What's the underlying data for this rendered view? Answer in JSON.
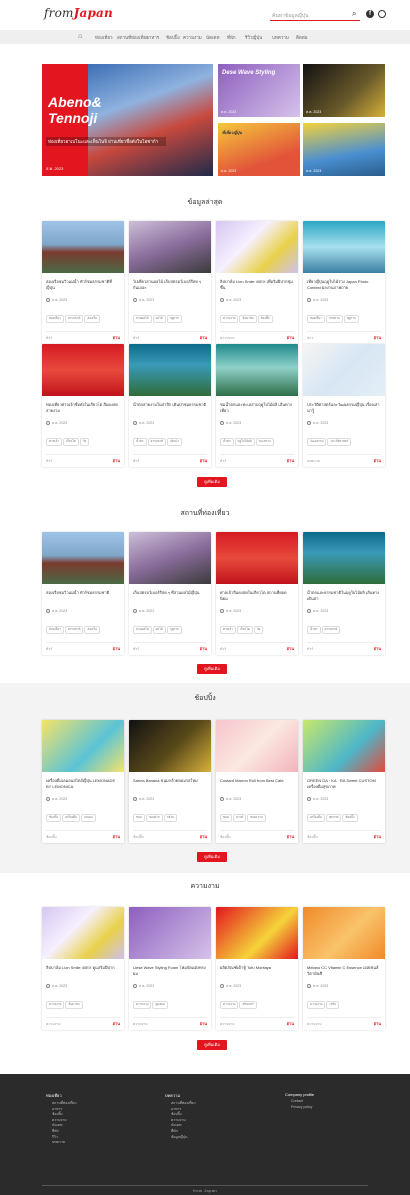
{
  "header": {
    "logo_left": "from",
    "logo_right": "Japan",
    "search_placeholder": "ค้นหาข้อมูลญี่ปุ่น"
  },
  "nav": {
    "items": [
      "ท่องเที่ยว",
      "สถานที่ท่องเที่ยว",
      "อาหาร",
      "ช้อปปิ้ง",
      "ความงาม",
      "นัดเดท",
      "ที่พัก",
      "รีวิวญี่ปุ่น",
      "บทความ",
      "ติดต่อ"
    ]
  },
  "banner": {
    "hero_title_1": "Abeno&",
    "hero_title_2": "Tennoji",
    "hero_sub": "ท่องเที่ยวอาเบโนะและเท็นโนจิ ย่านเที่ยวชื่อดังในโอซาก้า",
    "hero_date": "ส.ค. 2023",
    "tiles": [
      {
        "caption": "Dese Wave Styling",
        "date": "ส.ค. 2023"
      },
      {
        "caption": "",
        "date": "ส.ค. 2023"
      },
      {
        "caption": "ที่เที่ยวญี่ปุ่น",
        "date": "ส.ค. 2023"
      },
      {
        "caption": "",
        "date": "ส.ค. 2023"
      }
    ]
  },
  "sections": {
    "latest": "ข้อมูลล่าสุด",
    "places": "สถานที่ท่องเที่ยว",
    "shopping": "ช้อปปิ้ง",
    "beauty": "ความงาม"
  },
  "more_label": "ดูเพิ่มเติม",
  "read_more": "อ่าน",
  "latest_cards": [
    {
      "title": "ล่องเรือชมวิวแม่น้ำ ทัวร์ชมธรรมชาติที่ญี่ปุ่น",
      "date": "ส.ค. 2023",
      "tags": [
        "ท่องเที่ยว",
        "ธรรมชาติ",
        "ล่องเรือ"
      ],
      "cat": "ทัวร์"
    },
    {
      "title": "ไปเที่ยวสวนผลไม้ เก็บสตรอว์เบอร์รีสด ๆ กันเถอะ",
      "date": "ส.ค. 2023",
      "tags": [
        "สวนผลไม้",
        "ผลไม้",
        "ฤดูกาล"
      ],
      "cat": "ทัวร์"
    },
    {
      "title": "ลิปบาล์ม Lion Smile 40EX เพื่อริมฝีปากชุ่มชื้น",
      "date": "ส.ค. 2023",
      "tags": [
        "ความงาม",
        "ลิปบาล์ม",
        "ช้อปปิ้ง"
      ],
      "cat": "ความงาม"
    },
    {
      "title": "เที่ยวญี่ปุ่นฤดูใบไม้ร่วง Japan Photo Contest ผลงานภาพถ่าย",
      "date": "ส.ค. 2023",
      "tags": [
        "ท่องเที่ยว",
        "ภาพถ่าย",
        "ฤดูกาล"
      ],
      "cat": "ข่าว"
    },
    {
      "title": "ท่องเที่ยวศาลเจ้าชื่อดังในเกียวโต สีแดงสดสวยงาม",
      "date": "ส.ค. 2023",
      "tags": [
        "ศาลเจ้า",
        "เกียวโต",
        "วัด"
      ],
      "cat": "ทัวร์"
    },
    {
      "title": "น้ำตกสวยงามในป่าลึก เดินป่าชมธรรมชาติ",
      "date": "ส.ค. 2023",
      "tags": [
        "น้ำตก",
        "ธรรมชาติ",
        "เดินป่า"
      ],
      "cat": "ทัวร์"
    },
    {
      "title": "ชมน้ำตกและทะเลสาบฤดูใบไม้ผลิ เส้นทางเที่ยว",
      "date": "ส.ค. 2023",
      "tags": [
        "น้ำตก",
        "ฤดูใบไม้ผลิ",
        "ทะเลสาบ"
      ],
      "cat": "ทัวร์"
    },
    {
      "title": "ประวัติศาสตร์และวัฒนธรรมญี่ปุ่น เรื่องเล่าน่ารู้",
      "date": "ส.ค. 2023",
      "tags": [
        "วัฒนธรรม",
        "ประวัติศาสตร์"
      ],
      "cat": "บทความ"
    }
  ],
  "place_cards": [
    {
      "title": "ล่องเรือชมวิวแม่น้ำ ทัวร์ชมธรรมชาติ",
      "date": "ส.ค. 2023",
      "tags": [
        "ท่องเที่ยว",
        "ธรรมชาติ",
        "ล่องเรือ"
      ],
      "cat": "ทัวร์"
    },
    {
      "title": "เก็บสตรอว์เบอร์รีสด ๆ ที่สวนผลไม้ญี่ปุ่น",
      "date": "ส.ค. 2023",
      "tags": [
        "สวนผลไม้",
        "ผลไม้",
        "ฤดูกาล"
      ],
      "cat": "ทัวร์"
    },
    {
      "title": "ศาลเจ้าสีแดงสดในเกียวโต สถานที่ยอดนิยม",
      "date": "ส.ค. 2023",
      "tags": [
        "ศาลเจ้า",
        "เกียวโต",
        "วัด"
      ],
      "cat": "ทัวร์"
    },
    {
      "title": "น้ำตกและธรรมชาติในฤดูใบไม้ผลิ เส้นทางเดินป่า",
      "date": "ส.ค. 2023",
      "tags": [
        "น้ำตก",
        "ธรรมชาติ"
      ],
      "cat": "ทัวร์"
    }
  ],
  "shop_cards": [
    {
      "title": "เครื่องดื่มเลมอนสไตล์ญี่ปุ่น LEMONADE BY LEMONICA",
      "date": "ส.ค. 2023",
      "tags": [
        "ช้อปปิ้ง",
        "เครื่องดื่ม",
        "เลมอน"
      ],
      "cat": "ช้อปปิ้ง"
    },
    {
      "title": "Sanna Banana ขนมกล้วยหอมรสใหม่",
      "date": "ส.ค. 2023",
      "tags": [
        "ขนม",
        "ของฝาก",
        "กล้วย"
      ],
      "cat": "ช้อปปิ้ง"
    },
    {
      "title": "Custard Marron Roll from Best Cafe",
      "date": "ส.ค. 2023",
      "tags": [
        "ขนม",
        "คาเฟ่",
        "ของหวาน"
      ],
      "cat": "ช้อปปิ้ง"
    },
    {
      "title": "GREEN DA · KA · RA Sweet CUSTOM เครื่องดื่มสุขภาพ",
      "date": "ส.ค. 2023",
      "tags": [
        "เครื่องดื่ม",
        "สุขภาพ",
        "ช้อปปิ้ง"
      ],
      "cat": "ช้อปปิ้ง"
    }
  ],
  "beauty_cards": [
    {
      "title": "ลิปบาล์ม Lion Smile 40EX ดูแลริมฝีปาก",
      "date": "ส.ค. 2023",
      "tags": [
        "ความงาม",
        "ลิปบาล์ม"
      ],
      "cat": "ความงาม"
    },
    {
      "title": "Liese Wave Styling Foam โฟมจัดแต่งทรงผม",
      "date": "ส.ค. 2023",
      "tags": [
        "ความงาม",
        "ดูแลผม"
      ],
      "cat": "ความงาม"
    },
    {
      "title": "ผลิตภัณฑ์เต้าหู้ Tofu Moritaya",
      "date": "ส.ค. 2023",
      "tags": [
        "ความงาม",
        "สกินแคร์"
      ],
      "cat": "ความงาม"
    },
    {
      "title": "Melano CC Vitamin C Essence เอสเซนส์วิตามินซี",
      "date": "ส.ค. 2023",
      "tags": [
        "ความงาม",
        "เซรั่ม"
      ],
      "cat": "ความงาม"
    }
  ],
  "footer": {
    "col1_head": "ท่องเที่ยว",
    "col1_items": [
      "สถานที่ท่องเที่ยว",
      "อาหาร",
      "ช้อปปิ้ง",
      "ความงาม",
      "นัดเดท",
      "ที่พัก",
      "รีวิว",
      "บทความ"
    ],
    "col2_head": "บทความ",
    "col2_items": [
      "สถานที่ท่องเที่ยว",
      "อาหาร",
      "ช้อปปิ้ง",
      "ความงาม",
      "นัดเดท",
      "ที่พัก",
      "ข้อมูลญี่ปุ่น"
    ],
    "col3_head": "Company profile",
    "col3_items": [
      "Contact",
      "Privacy policy"
    ],
    "bottom_logo": "from Japan"
  }
}
